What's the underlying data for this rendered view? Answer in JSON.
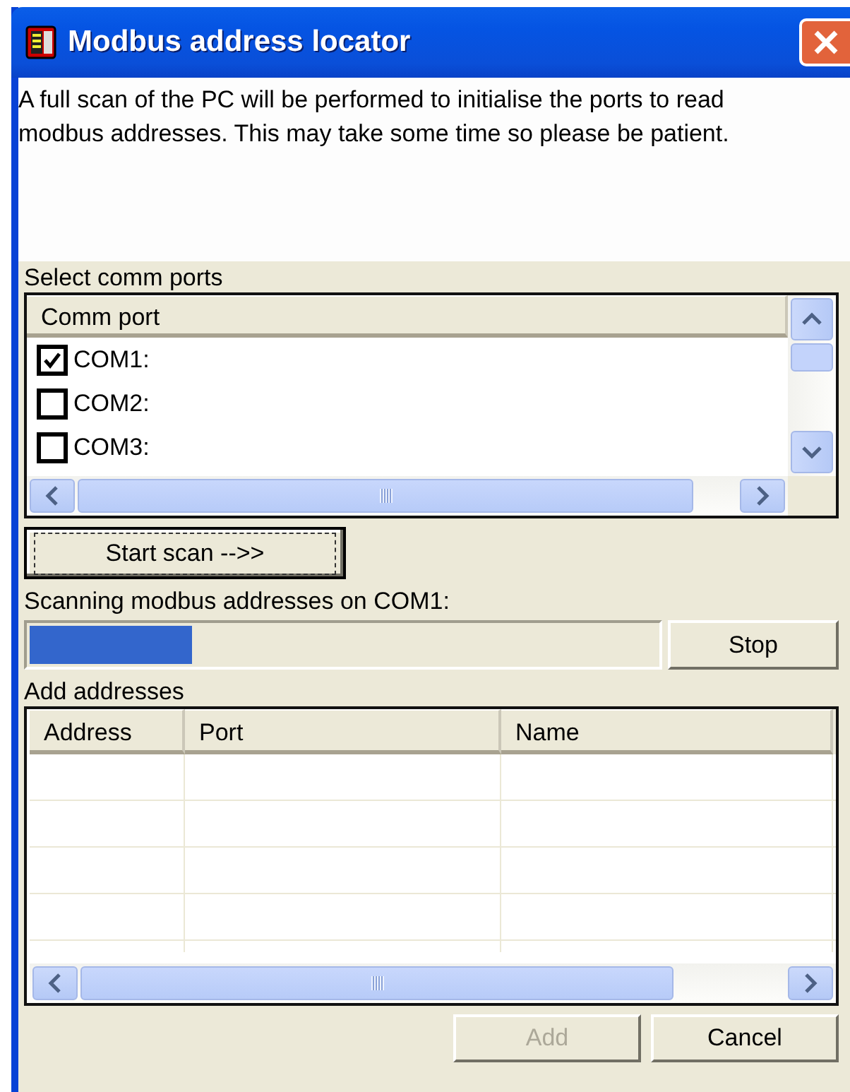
{
  "window": {
    "title": "Modbus address locator"
  },
  "description": "A full scan of the PC will be performed to initialise the ports to read modbus addresses. This may take some time so please be patient.",
  "comm_ports": {
    "label": "Select comm ports",
    "columns": [
      "Comm port"
    ],
    "rows": [
      {
        "label": "COM1:",
        "checked": true
      },
      {
        "label": "COM2:",
        "checked": false
      },
      {
        "label": "COM3:",
        "checked": false
      }
    ]
  },
  "start_button": {
    "label": "Start scan -->>",
    "focused": true
  },
  "scan_status": "Scanning modbus addresses on COM1:",
  "progress": {
    "level": 0.26
  },
  "stop_button": {
    "label": "Stop"
  },
  "addresses": {
    "label": "Add addresses",
    "columns": [
      "Address",
      "Port",
      "Name"
    ]
  },
  "buttons": [
    {
      "label": "Add",
      "disabled": true
    },
    {
      "label": "Cancel",
      "disabled": false
    }
  ]
}
